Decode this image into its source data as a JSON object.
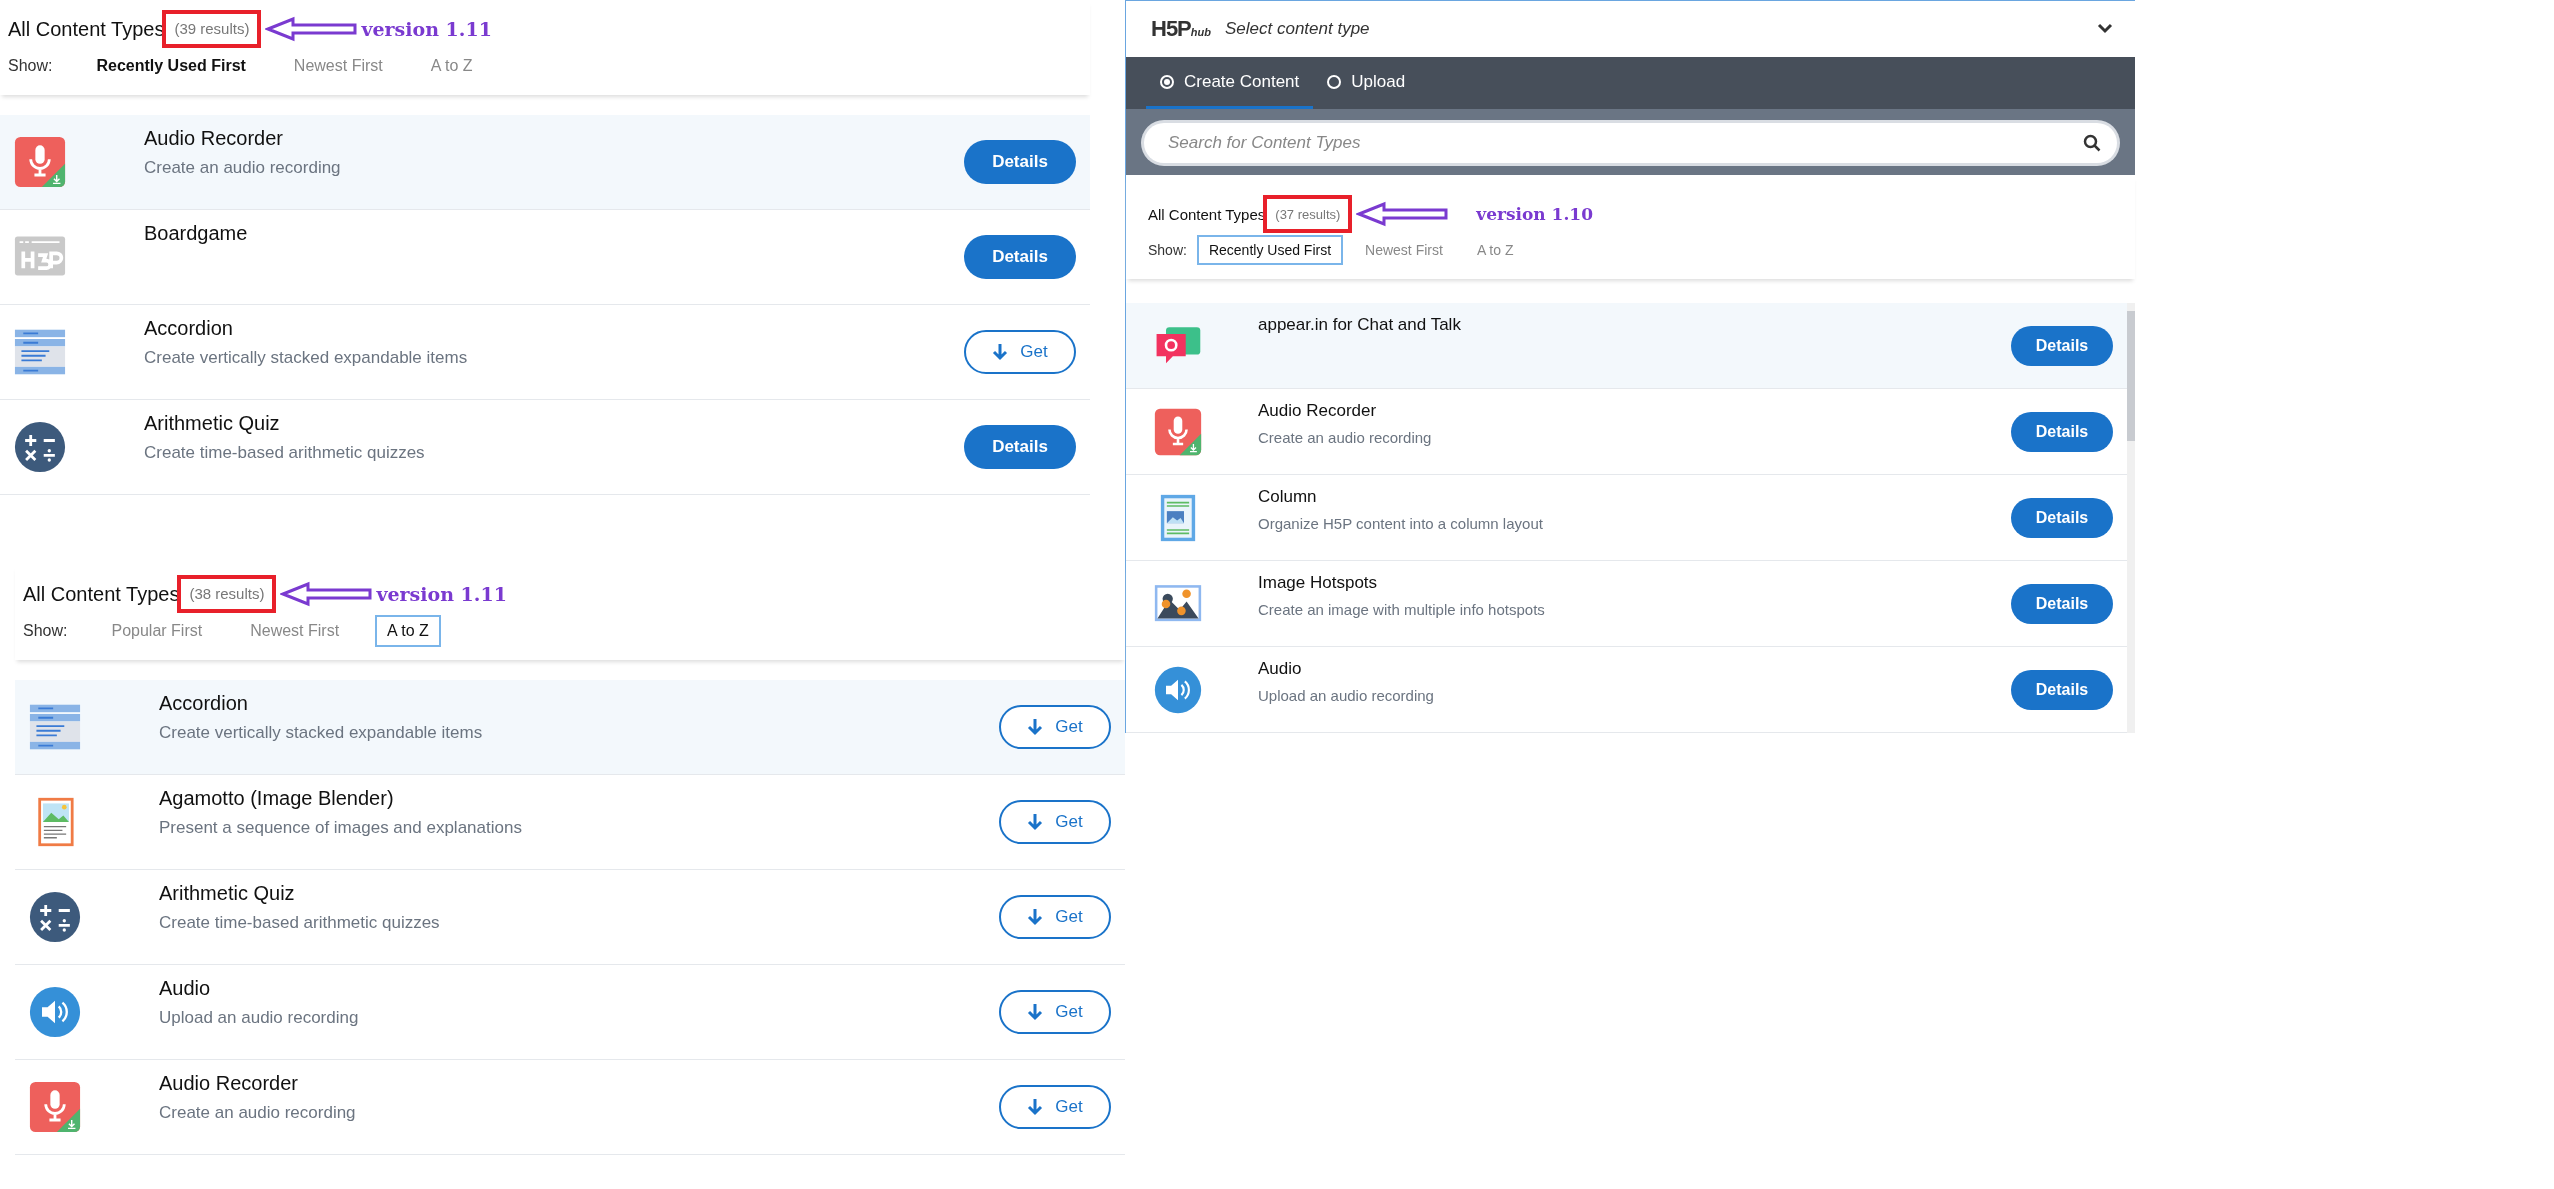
{
  "panels": [
    {
      "kind": "bold",
      "heading": "All Content Types",
      "results": "(39 results)",
      "note": "version 1.11",
      "show_label": "Show:",
      "sort_options": [
        {
          "label": "Recently Used First",
          "selected": true
        },
        {
          "label": "Newest First",
          "selected": false
        },
        {
          "label": "A to Z",
          "selected": false
        }
      ],
      "items": [
        {
          "kind": "recorder",
          "title": "Audio Recorder",
          "description": "Create an audio recording",
          "highlighted": true,
          "action": {
            "kind": "details",
            "label": "Details"
          }
        },
        {
          "kind": "boardgame",
          "title": "Boardgame",
          "highlighted": false,
          "action": {
            "kind": "details",
            "label": "Details"
          }
        },
        {
          "kind": "accordion",
          "title": "Accordion",
          "description": "Create vertically stacked expandable items",
          "highlighted": false,
          "action": {
            "kind": "get",
            "label": "Get"
          }
        },
        {
          "kind": "arithmetic",
          "title": "Arithmetic Quiz",
          "description": "Create time-based arithmetic quizzes",
          "highlighted": false,
          "action": {
            "kind": "details",
            "label": "Details"
          }
        }
      ]
    },
    {
      "kind": "boxed",
      "heading": "All Content Types",
      "results": "(38 results)",
      "note": "version 1.11",
      "show_label": "Show:",
      "sort_options": [
        {
          "label": "Popular First",
          "selected": false
        },
        {
          "label": "Newest First",
          "selected": false
        },
        {
          "label": "A to Z",
          "selected": true
        }
      ],
      "items": [
        {
          "kind": "accordion",
          "title": "Accordion",
          "description": "Create vertically stacked expandable items",
          "highlighted": true,
          "action": {
            "kind": "get",
            "label": "Get"
          }
        },
        {
          "kind": "agamotto",
          "title": "Agamotto (Image Blender)",
          "description": "Present a sequence of images and explanations",
          "highlighted": false,
          "action": {
            "kind": "get",
            "label": "Get"
          }
        },
        {
          "kind": "arithmetic",
          "title": "Arithmetic Quiz",
          "description": "Create time-based arithmetic quizzes",
          "highlighted": false,
          "action": {
            "kind": "get",
            "label": "Get"
          }
        },
        {
          "kind": "audio",
          "title": "Audio",
          "description": "Upload an audio recording",
          "highlighted": false,
          "action": {
            "kind": "get",
            "label": "Get"
          }
        },
        {
          "kind": "recorder",
          "title": "Audio Recorder",
          "description": "Create an audio recording",
          "highlighted": false,
          "action": {
            "kind": "get",
            "label": "Get"
          }
        }
      ]
    },
    {
      "kind": "boxed",
      "hub": {
        "logo": "H5P",
        "logo_sub": "hub",
        "title": "Select content type",
        "tabs": [
          {
            "label": "Create Content",
            "selected": true
          },
          {
            "label": "Upload",
            "selected": false
          }
        ],
        "search": {
          "placeholder": "Search for Content Types"
        }
      },
      "heading": "All Content Types",
      "results": "(37 results)",
      "note": "version 1.10",
      "show_label": "Show:",
      "sort_options": [
        {
          "label": "Recently Used First",
          "selected": true
        },
        {
          "label": "Newest First",
          "selected": false
        },
        {
          "label": "A to Z",
          "selected": false
        }
      ],
      "items": [
        {
          "kind": "appear",
          "title": "appear.in for Chat and Talk",
          "highlighted": true,
          "action": {
            "kind": "details",
            "label": "Details"
          }
        },
        {
          "kind": "recorder",
          "title": "Audio Recorder",
          "description": "Create an audio recording",
          "highlighted": false,
          "action": {
            "kind": "details",
            "label": "Details"
          }
        },
        {
          "kind": "column",
          "title": "Column",
          "description": "Organize H5P content into a column layout",
          "highlighted": false,
          "action": {
            "kind": "details",
            "label": "Details"
          }
        },
        {
          "kind": "hotspots",
          "title": "Image Hotspots",
          "description": "Create an image with multiple info hotspots",
          "highlighted": false,
          "action": {
            "kind": "details",
            "label": "Details"
          }
        },
        {
          "kind": "audio",
          "title": "Audio",
          "description": "Upload an audio recording",
          "highlighted": false,
          "action": {
            "kind": "details",
            "label": "Details"
          }
        }
      ]
    }
  ]
}
